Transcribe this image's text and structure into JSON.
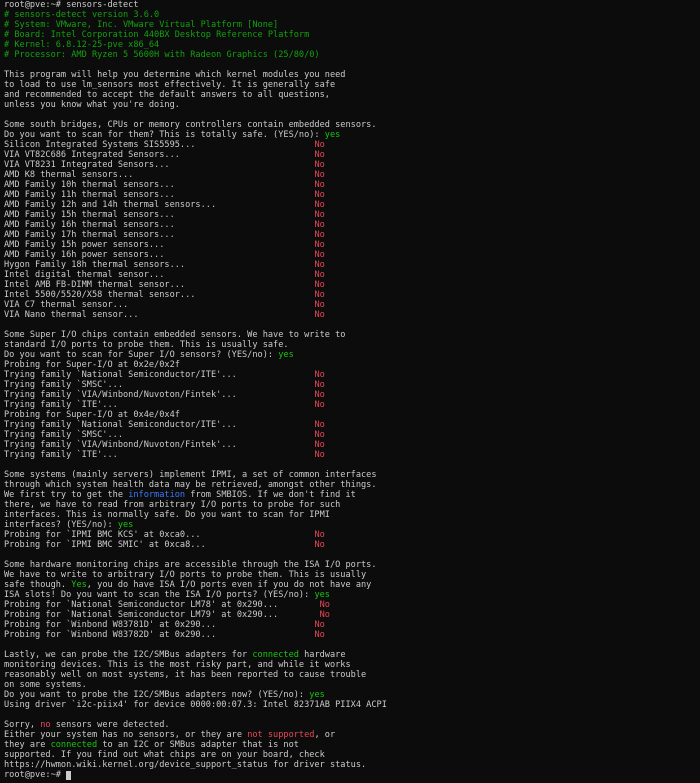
{
  "colors": {
    "background": "#0c0c0c",
    "text": "#cccccc",
    "comment": "#13a10e",
    "yes": "#16c60c",
    "no": "#e74856",
    "link": "#3b78ff"
  },
  "prompt": "root@pve:~#",
  "lines": [
    {
      "type": "prompt",
      "parts": [
        {
          "text": "root@pve:~# sensors-detect",
          "c": "gray"
        }
      ]
    },
    {
      "type": "text",
      "parts": [
        {
          "text": "# sensors-detect version 3.6.0",
          "c": "green-dim"
        }
      ]
    },
    {
      "type": "text",
      "parts": [
        {
          "text": "# System: VMware, Inc. VMware Virtual Platform [None]",
          "c": "green-dim"
        }
      ]
    },
    {
      "type": "text",
      "parts": [
        {
          "text": "# Board: Intel Corporation 440BX Desktop Reference Platform",
          "c": "green-dim"
        }
      ]
    },
    {
      "type": "text",
      "parts": [
        {
          "text": "# Kernel: 6.8.12-25-pve x86_64",
          "c": "green-dim"
        }
      ]
    },
    {
      "type": "text",
      "parts": [
        {
          "text": "# Processor: AMD Ryzen 5 5600H with Radeon Graphics (25/80/0)",
          "c": "green-dim"
        }
      ]
    },
    {
      "type": "blank",
      "parts": []
    },
    {
      "type": "text",
      "parts": [
        {
          "text": "This program will help you determine which kernel modules you need",
          "c": "gray"
        }
      ]
    },
    {
      "type": "text",
      "parts": [
        {
          "text": "to load to use lm_sensors most effectively. It is generally safe",
          "c": "gray"
        }
      ]
    },
    {
      "type": "text",
      "parts": [
        {
          "text": "and recommended to accept the default answers to all questions,",
          "c": "gray"
        }
      ]
    },
    {
      "type": "text",
      "parts": [
        {
          "text": "unless you know what you're doing.",
          "c": "gray"
        }
      ]
    },
    {
      "type": "blank",
      "parts": []
    },
    {
      "type": "text",
      "parts": [
        {
          "text": "Some south bridges, CPUs or memory controllers contain embedded sensors.",
          "c": "gray"
        }
      ]
    },
    {
      "type": "text",
      "parts": [
        {
          "text": "Do you want to scan for them? This is totally safe. (YES/no): ",
          "c": "gray"
        },
        {
          "text": "yes",
          "c": "green"
        }
      ]
    },
    {
      "type": "text",
      "parts": [
        {
          "text": "Silicon Integrated Systems SIS5595...                       ",
          "c": "gray"
        },
        {
          "text": "No",
          "c": "red"
        }
      ]
    },
    {
      "type": "text",
      "parts": [
        {
          "text": "VIA VT82C686 Integrated Sensors...                          ",
          "c": "gray"
        },
        {
          "text": "No",
          "c": "red"
        }
      ]
    },
    {
      "type": "text",
      "parts": [
        {
          "text": "VIA VT8231 Integrated Sensors...                            ",
          "c": "gray"
        },
        {
          "text": "No",
          "c": "red"
        }
      ]
    },
    {
      "type": "text",
      "parts": [
        {
          "text": "AMD K8 thermal sensors...                                   ",
          "c": "gray"
        },
        {
          "text": "No",
          "c": "red"
        }
      ]
    },
    {
      "type": "text",
      "parts": [
        {
          "text": "AMD Family 10h thermal sensors...                           ",
          "c": "gray"
        },
        {
          "text": "No",
          "c": "red"
        }
      ]
    },
    {
      "type": "text",
      "parts": [
        {
          "text": "AMD Family 11h thermal sensors...                           ",
          "c": "gray"
        },
        {
          "text": "No",
          "c": "red"
        }
      ]
    },
    {
      "type": "text",
      "parts": [
        {
          "text": "AMD Family 12h and 14h thermal sensors...                   ",
          "c": "gray"
        },
        {
          "text": "No",
          "c": "red"
        }
      ]
    },
    {
      "type": "text",
      "parts": [
        {
          "text": "AMD Family 15h thermal sensors...                           ",
          "c": "gray"
        },
        {
          "text": "No",
          "c": "red"
        }
      ]
    },
    {
      "type": "text",
      "parts": [
        {
          "text": "AMD Family 16h thermal sensors...                           ",
          "c": "gray"
        },
        {
          "text": "No",
          "c": "red"
        }
      ]
    },
    {
      "type": "text",
      "parts": [
        {
          "text": "AMD Family 17h thermal sensors...                           ",
          "c": "gray"
        },
        {
          "text": "No",
          "c": "red"
        }
      ]
    },
    {
      "type": "text",
      "parts": [
        {
          "text": "AMD Family 15h power sensors...                             ",
          "c": "gray"
        },
        {
          "text": "No",
          "c": "red"
        }
      ]
    },
    {
      "type": "text",
      "parts": [
        {
          "text": "AMD Family 16h power sensors...                             ",
          "c": "gray"
        },
        {
          "text": "No",
          "c": "red"
        }
      ]
    },
    {
      "type": "text",
      "parts": [
        {
          "text": "Hygon Family 18h thermal sensors...                         ",
          "c": "gray"
        },
        {
          "text": "No",
          "c": "red"
        }
      ]
    },
    {
      "type": "text",
      "parts": [
        {
          "text": "Intel digital thermal sensor...                             ",
          "c": "gray"
        },
        {
          "text": "No",
          "c": "red"
        }
      ]
    },
    {
      "type": "text",
      "parts": [
        {
          "text": "Intel AMB FB-DIMM thermal sensor...                         ",
          "c": "gray"
        },
        {
          "text": "No",
          "c": "red"
        }
      ]
    },
    {
      "type": "text",
      "parts": [
        {
          "text": "Intel 5500/5520/X58 thermal sensor...                       ",
          "c": "gray"
        },
        {
          "text": "No",
          "c": "red"
        }
      ]
    },
    {
      "type": "text",
      "parts": [
        {
          "text": "VIA C7 thermal sensor...                                    ",
          "c": "gray"
        },
        {
          "text": "No",
          "c": "red"
        }
      ]
    },
    {
      "type": "text",
      "parts": [
        {
          "text": "VIA Nano thermal sensor...                                  ",
          "c": "gray"
        },
        {
          "text": "No",
          "c": "red"
        }
      ]
    },
    {
      "type": "blank",
      "parts": []
    },
    {
      "type": "text",
      "parts": [
        {
          "text": "Some Super I/O chips contain embedded sensors. We have to write to",
          "c": "gray"
        }
      ]
    },
    {
      "type": "text",
      "parts": [
        {
          "text": "standard I/O ports to probe them. This is usually safe.",
          "c": "gray"
        }
      ]
    },
    {
      "type": "text",
      "parts": [
        {
          "text": "Do you want to scan for Super I/O sensors? (YES/no): ",
          "c": "gray"
        },
        {
          "text": "yes",
          "c": "green"
        }
      ]
    },
    {
      "type": "text",
      "parts": [
        {
          "text": "Probing for Super-I/O at 0x2e/0x2f",
          "c": "gray"
        }
      ]
    },
    {
      "type": "text",
      "parts": [
        {
          "text": "Trying family `National Semiconductor/ITE'...               ",
          "c": "gray"
        },
        {
          "text": "No",
          "c": "red"
        }
      ]
    },
    {
      "type": "text",
      "parts": [
        {
          "text": "Trying family `SMSC'...                                     ",
          "c": "gray"
        },
        {
          "text": "No",
          "c": "red"
        }
      ]
    },
    {
      "type": "text",
      "parts": [
        {
          "text": "Trying family `VIA/Winbond/Nuvoton/Fintek'...               ",
          "c": "gray"
        },
        {
          "text": "No",
          "c": "red"
        }
      ]
    },
    {
      "type": "text",
      "parts": [
        {
          "text": "Trying family `ITE'...                                      ",
          "c": "gray"
        },
        {
          "text": "No",
          "c": "red"
        }
      ]
    },
    {
      "type": "text",
      "parts": [
        {
          "text": "Probing for Super-I/O at 0x4e/0x4f",
          "c": "gray"
        }
      ]
    },
    {
      "type": "text",
      "parts": [
        {
          "text": "Trying family `National Semiconductor/ITE'...               ",
          "c": "gray"
        },
        {
          "text": "No",
          "c": "red"
        }
      ]
    },
    {
      "type": "text",
      "parts": [
        {
          "text": "Trying family `SMSC'...                                     ",
          "c": "gray"
        },
        {
          "text": "No",
          "c": "red"
        }
      ]
    },
    {
      "type": "text",
      "parts": [
        {
          "text": "Trying family `VIA/Winbond/Nuvoton/Fintek'...               ",
          "c": "gray"
        },
        {
          "text": "No",
          "c": "red"
        }
      ]
    },
    {
      "type": "text",
      "parts": [
        {
          "text": "Trying family `ITE'...                                      ",
          "c": "gray"
        },
        {
          "text": "No",
          "c": "red"
        }
      ]
    },
    {
      "type": "blank",
      "parts": []
    },
    {
      "type": "text",
      "parts": [
        {
          "text": "Some systems (mainly servers) implement IPMI, a set of common interfaces",
          "c": "gray"
        }
      ]
    },
    {
      "type": "text",
      "parts": [
        {
          "text": "through which system health data may be retrieved, amongst other things.",
          "c": "gray"
        }
      ]
    },
    {
      "type": "text",
      "parts": [
        {
          "text": "We first try to get the ",
          "c": "gray"
        },
        {
          "text": "information",
          "c": "blue"
        },
        {
          "text": " from SMBIOS. If we don't find it",
          "c": "gray"
        }
      ]
    },
    {
      "type": "text",
      "parts": [
        {
          "text": "there, we have to read from arbitrary I/O ports to probe for such",
          "c": "gray"
        }
      ]
    },
    {
      "type": "text",
      "parts": [
        {
          "text": "interfaces. This is normally safe. Do you want to scan for IPMI",
          "c": "gray"
        }
      ]
    },
    {
      "type": "text",
      "parts": [
        {
          "text": "interfaces? (YES/no): ",
          "c": "gray"
        },
        {
          "text": "yes",
          "c": "green"
        }
      ]
    },
    {
      "type": "text",
      "parts": [
        {
          "text": "Probing for `IPMI BMC KCS' at 0xca0...                      ",
          "c": "gray"
        },
        {
          "text": "No",
          "c": "red"
        }
      ]
    },
    {
      "type": "text",
      "parts": [
        {
          "text": "Probing for `IPMI BMC SMIC' at 0xca8...                     ",
          "c": "gray"
        },
        {
          "text": "No",
          "c": "red"
        }
      ]
    },
    {
      "type": "blank",
      "parts": []
    },
    {
      "type": "text",
      "parts": [
        {
          "text": "Some hardware monitoring chips are accessible through the ISA I/O ports.",
          "c": "gray"
        }
      ]
    },
    {
      "type": "text",
      "parts": [
        {
          "text": "We have to write to arbitrary I/O ports to probe them. This is usually",
          "c": "gray"
        }
      ]
    },
    {
      "type": "text",
      "parts": [
        {
          "text": "safe though. ",
          "c": "gray"
        },
        {
          "text": "Yes",
          "c": "green"
        },
        {
          "text": ", you do have ISA I/O ports even if you do not have any",
          "c": "gray"
        }
      ]
    },
    {
      "type": "text",
      "parts": [
        {
          "text": "ISA slots! Do you want to scan the ISA I/O ports? (YES/no): ",
          "c": "gray"
        },
        {
          "text": "yes",
          "c": "green"
        }
      ]
    },
    {
      "type": "text",
      "parts": [
        {
          "text": "Probing for `National Semiconductor LM78' at 0x290...        ",
          "c": "gray"
        },
        {
          "text": "No",
          "c": "red"
        }
      ]
    },
    {
      "type": "text",
      "parts": [
        {
          "text": "Probing for `National Semiconductor LM79' at 0x290...        ",
          "c": "gray"
        },
        {
          "text": "No",
          "c": "red"
        }
      ]
    },
    {
      "type": "text",
      "parts": [
        {
          "text": "Probing for `Winbond W83781D' at 0x290...                   ",
          "c": "gray"
        },
        {
          "text": "No",
          "c": "red"
        }
      ]
    },
    {
      "type": "text",
      "parts": [
        {
          "text": "Probing for `Winbond W83782D' at 0x290...                   ",
          "c": "gray"
        },
        {
          "text": "No",
          "c": "red"
        }
      ]
    },
    {
      "type": "blank",
      "parts": []
    },
    {
      "type": "text",
      "parts": [
        {
          "text": "Lastly, we can probe the I2C/SMBus adapters for ",
          "c": "gray"
        },
        {
          "text": "connected",
          "c": "green"
        },
        {
          "text": " hardware",
          "c": "gray"
        }
      ]
    },
    {
      "type": "text",
      "parts": [
        {
          "text": "monitoring devices. This is the most risky part, and while it works",
          "c": "gray"
        }
      ]
    },
    {
      "type": "text",
      "parts": [
        {
          "text": "reasonably well on most systems, it has been reported to cause trouble",
          "c": "gray"
        }
      ]
    },
    {
      "type": "text",
      "parts": [
        {
          "text": "on some systems.",
          "c": "gray"
        }
      ]
    },
    {
      "type": "text",
      "parts": [
        {
          "text": "Do you want to probe the I2C/SMBus adapters now? (YES/no): ",
          "c": "gray"
        },
        {
          "text": "yes",
          "c": "green"
        }
      ]
    },
    {
      "type": "text",
      "parts": [
        {
          "text": "Using driver `i2c-piix4' for device 0000:00:07.3: Intel 82371AB PIIX4 ACPI",
          "c": "gray"
        }
      ]
    },
    {
      "type": "blank",
      "parts": []
    },
    {
      "type": "text",
      "parts": [
        {
          "text": "Sorry, ",
          "c": "gray"
        },
        {
          "text": "no",
          "c": "red"
        },
        {
          "text": " sensors were detected.",
          "c": "gray"
        }
      ]
    },
    {
      "type": "text",
      "parts": [
        {
          "text": "Either your system has no sensors, or they are ",
          "c": "gray"
        },
        {
          "text": "not supported",
          "c": "red"
        },
        {
          "text": ", or",
          "c": "gray"
        }
      ]
    },
    {
      "type": "text",
      "parts": [
        {
          "text": "they are ",
          "c": "gray"
        },
        {
          "text": "connected",
          "c": "green"
        },
        {
          "text": " to an I2C or SMBus adapter that is not",
          "c": "gray"
        }
      ]
    },
    {
      "type": "text",
      "parts": [
        {
          "text": "supported. If you find out what chips are on your board, check",
          "c": "gray"
        }
      ]
    },
    {
      "type": "text",
      "parts": [
        {
          "text": "https://hwmon.wiki.kernel.org/device_support_status for driver status.",
          "c": "gray"
        }
      ]
    },
    {
      "type": "prompt_cursor",
      "parts": [
        {
          "text": "root@pve:~# ",
          "c": "gray"
        }
      ]
    }
  ]
}
